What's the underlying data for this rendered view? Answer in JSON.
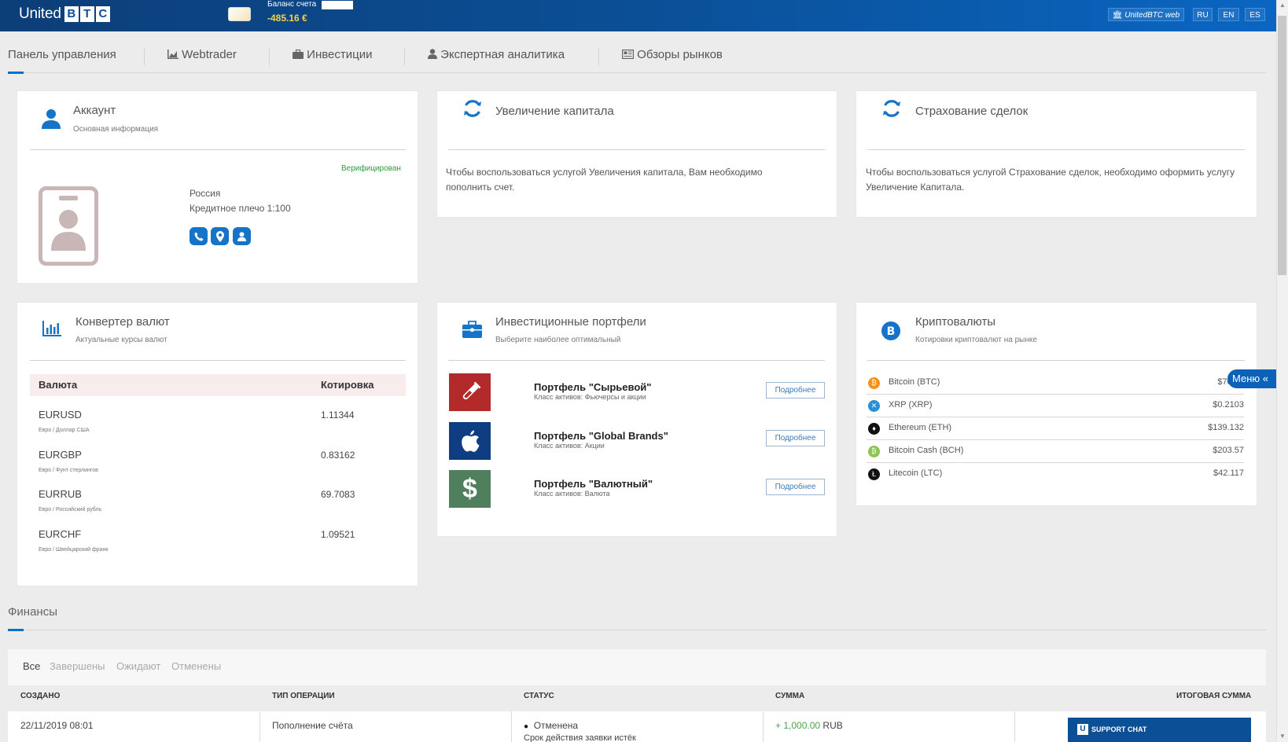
{
  "topbar": {
    "logo_word": "United",
    "logo_letters": [
      "B",
      "T",
      "C"
    ],
    "balance_label": "Баланс счета",
    "balance_value": "-485.16 €",
    "web_button": "UnitedBTC web",
    "langs": [
      "RU",
      "EN",
      "ES"
    ]
  },
  "nav": {
    "items": [
      {
        "label": "Панель управления",
        "icon": null
      },
      {
        "label": "Webtrader",
        "icon": "area-chart-icon"
      },
      {
        "label": "Инвестиции",
        "icon": "briefcase-icon"
      },
      {
        "label": "Экспертная аналитика",
        "icon": "user-tie-icon"
      },
      {
        "label": "Обзоры рынков",
        "icon": "newspaper-icon"
      }
    ]
  },
  "account": {
    "title": "Аккаунт",
    "subtitle": "Основная информация",
    "verified": "Верифицирован",
    "country": "Россия",
    "leverage": "Кредитное плечо 1:100"
  },
  "capital": {
    "title": "Увеличение капитала",
    "text": "Чтобы воспользоваться услугой Увеличения капитала, Вам необходимо пополнить счет."
  },
  "insurance": {
    "title": "Страхование сделок",
    "text": "Чтобы воспользоваться услугой Страхование сделок, необходимо оформить услугу Увеличение Капитала."
  },
  "converter": {
    "title": "Конвертер валют",
    "subtitle": "Актуальные курсы валют",
    "col_currency": "Валюта",
    "col_quote": "Котировка",
    "rows": [
      {
        "code": "EURUSD",
        "name": "Евро / Доллар США",
        "value": "1.11344"
      },
      {
        "code": "EURGBP",
        "name": "Евро / Фунт стерлингов",
        "value": "0.83162"
      },
      {
        "code": "EURRUB",
        "name": "Евро / Российский рубль",
        "value": "69.7083"
      },
      {
        "code": "EURCHF",
        "name": "Евро / Швейцарский франк",
        "value": "1.09521"
      }
    ]
  },
  "portfolios": {
    "title": "Инвестиционные портфели",
    "subtitle": "Выберите наиболее оптимальный",
    "button": "Подробнее",
    "items": [
      {
        "name": "Портфель \"Сырьевой\"",
        "cls": "Класс активов: Фьючерсы и акции",
        "color": "#b32a2a"
      },
      {
        "name": "Портфель \"Global Brands\"",
        "cls": "Класс активов: Акции",
        "color": "#0e3d82"
      },
      {
        "name": "Портфель \"Валютный\"",
        "cls": "Класс активов: Валюта",
        "color": "#4f7f5c"
      }
    ]
  },
  "crypto": {
    "title": "Криптовалюты",
    "subtitle": "Котировки криптовалют на рынке",
    "items": [
      {
        "name": "Bitcoin (BTC)",
        "price": "$7036.",
        "color": "#f7931a",
        "glyph": "₿"
      },
      {
        "name": "XRP (XRP)",
        "price": "$0.2103",
        "color": "#2a8fd6",
        "glyph": "✕"
      },
      {
        "name": "Ethereum (ETH)",
        "price": "$139.132",
        "color": "#111111",
        "glyph": "♦"
      },
      {
        "name": "Bitcoin Cash (BCH)",
        "price": "$203.57",
        "color": "#8dc351",
        "glyph": "₿"
      },
      {
        "name": "Litecoin (LTC)",
        "price": "$42.117",
        "color": "#111111",
        "glyph": "Ł"
      }
    ]
  },
  "menu_tab": "Меню «",
  "finance": {
    "title": "Финансы",
    "filters": [
      "Все",
      "Завершены",
      "Ожидают",
      "Отменены"
    ],
    "columns": [
      "СОЗДАНО",
      "ТИП ОПЕРАЦИИ",
      "СТАТУС",
      "СУММА",
      "ИТОГОВАЯ СУММА"
    ],
    "row": {
      "created": "22/11/2019 08:01",
      "type": "Пополнение счёта",
      "status": "Отменена",
      "status_note": "Срок действия заявки истёк",
      "amount": "+ 1,000.00",
      "currency": "RUB"
    }
  },
  "support": "SUPPORT CHAT",
  "colors": {
    "brand": "#0b4f96",
    "accent": "#1674c8",
    "verified": "#2e9a3e",
    "amount": "#4aa64a"
  }
}
